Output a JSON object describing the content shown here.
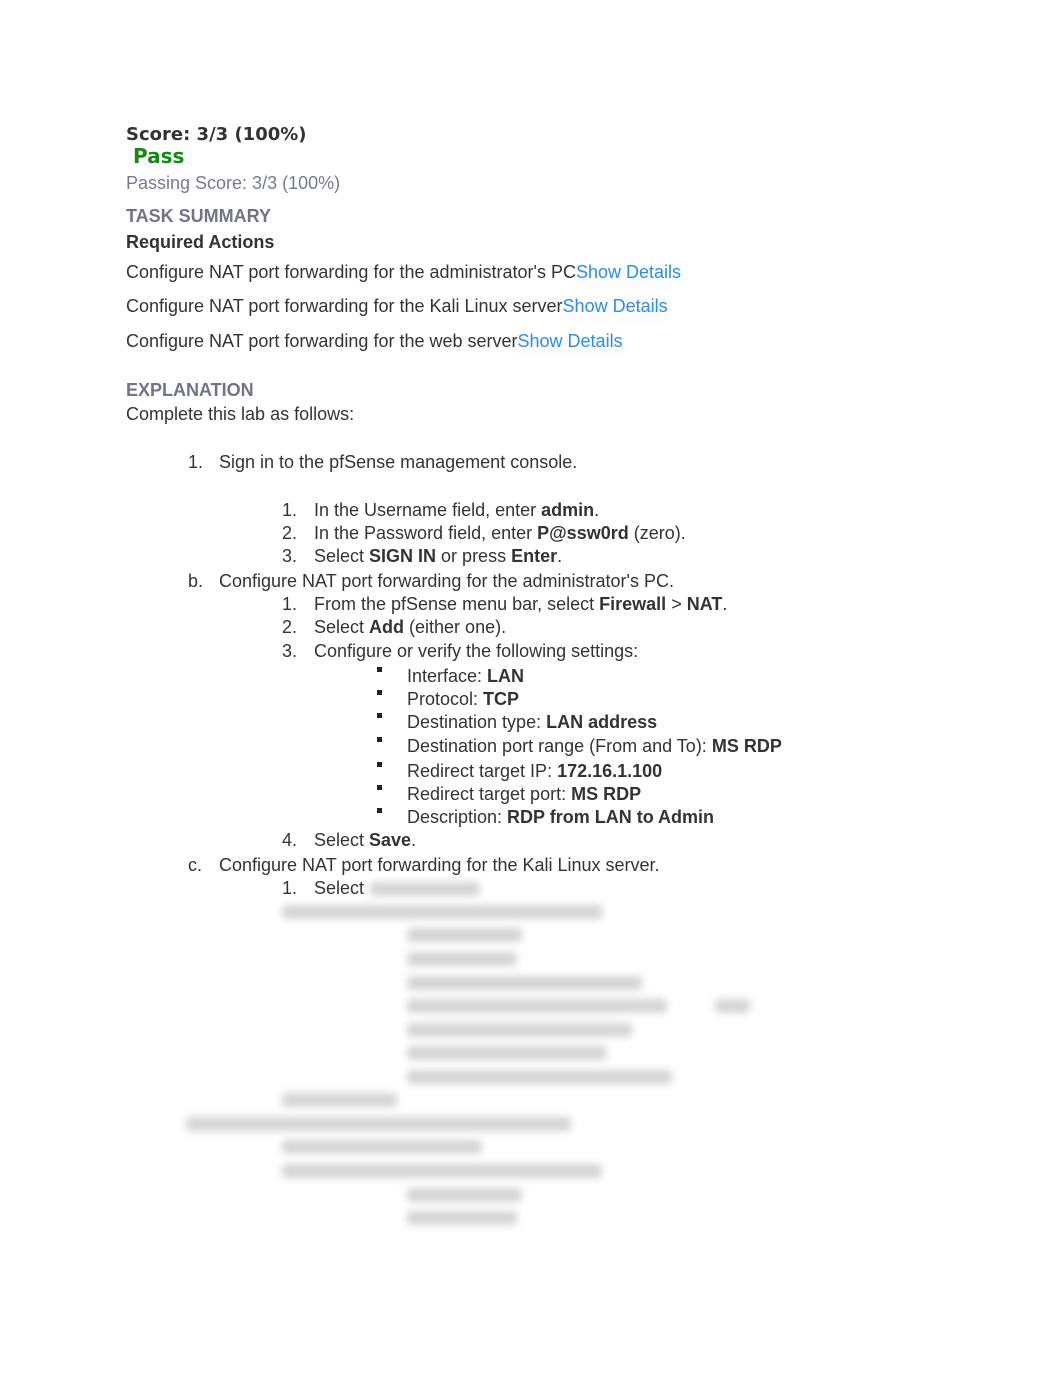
{
  "score": {
    "label": "Score: 3/3 (100%)",
    "result": "Pass",
    "passing": "Passing Score: 3/3 (100%)",
    "result_color": "#138a13"
  },
  "task_summary": {
    "heading": "TASK SUMMARY",
    "subheading": "Required Actions",
    "show_details_label": "Show Details",
    "items": [
      "Configure NAT port forwarding for the administrator's PC",
      "Configure NAT port forwarding for the Kali Linux server",
      "Configure NAT port forwarding for the web server"
    ]
  },
  "explanation": {
    "heading": "EXPLANATION",
    "intro": "Complete this lab as follows:",
    "step1": {
      "marker": "1.",
      "text": "Sign in to the pfSense management console.",
      "sub": [
        {
          "marker": "1.",
          "pre": "In the Username field, enter ",
          "bold": "admin",
          "post": "."
        },
        {
          "marker": "2.",
          "pre": "In the Password field, enter ",
          "bold": "P@ssw0rd",
          "post": " (zero)."
        },
        {
          "marker": "3.",
          "pre": "Select ",
          "bold": "SIGN IN",
          "mid": " or press ",
          "bold2": "Enter",
          "post": "."
        }
      ]
    },
    "step_b": {
      "marker": "b.",
      "text": "Configure NAT port forwarding for the administrator's PC.",
      "sub": [
        {
          "marker": "1.",
          "pre": "From the pfSense menu bar, select ",
          "bold": "Firewall",
          "mid": " > ",
          "bold2": "NAT",
          "post": "."
        },
        {
          "marker": "2.",
          "pre": "Select ",
          "bold": "Add",
          "post": " (either one)."
        },
        {
          "marker": "3.",
          "pre": "Configure or verify the following settings:"
        },
        {
          "marker": "4.",
          "pre": "Select ",
          "bold": "Save",
          "post": "."
        }
      ],
      "settings": [
        {
          "label": "Interface: ",
          "value": "LAN"
        },
        {
          "label": "Protocol: ",
          "value": "TCP"
        },
        {
          "label": "Destination type: ",
          "value": "LAN address"
        },
        {
          "label": "Destination port range (From and To): ",
          "value": "MS RDP"
        },
        {
          "label": "Redirect target IP: ",
          "value": "172.16.1.100"
        },
        {
          "label": "Redirect target port: ",
          "value": "MS RDP"
        },
        {
          "label": "Description: ",
          "value": "RDP from LAN to Admin"
        }
      ]
    },
    "step_c": {
      "marker": "c.",
      "text": "Configure NAT port forwarding for the Kali Linux server.",
      "sub1": {
        "marker": "1.",
        "pre": "Select"
      }
    }
  }
}
